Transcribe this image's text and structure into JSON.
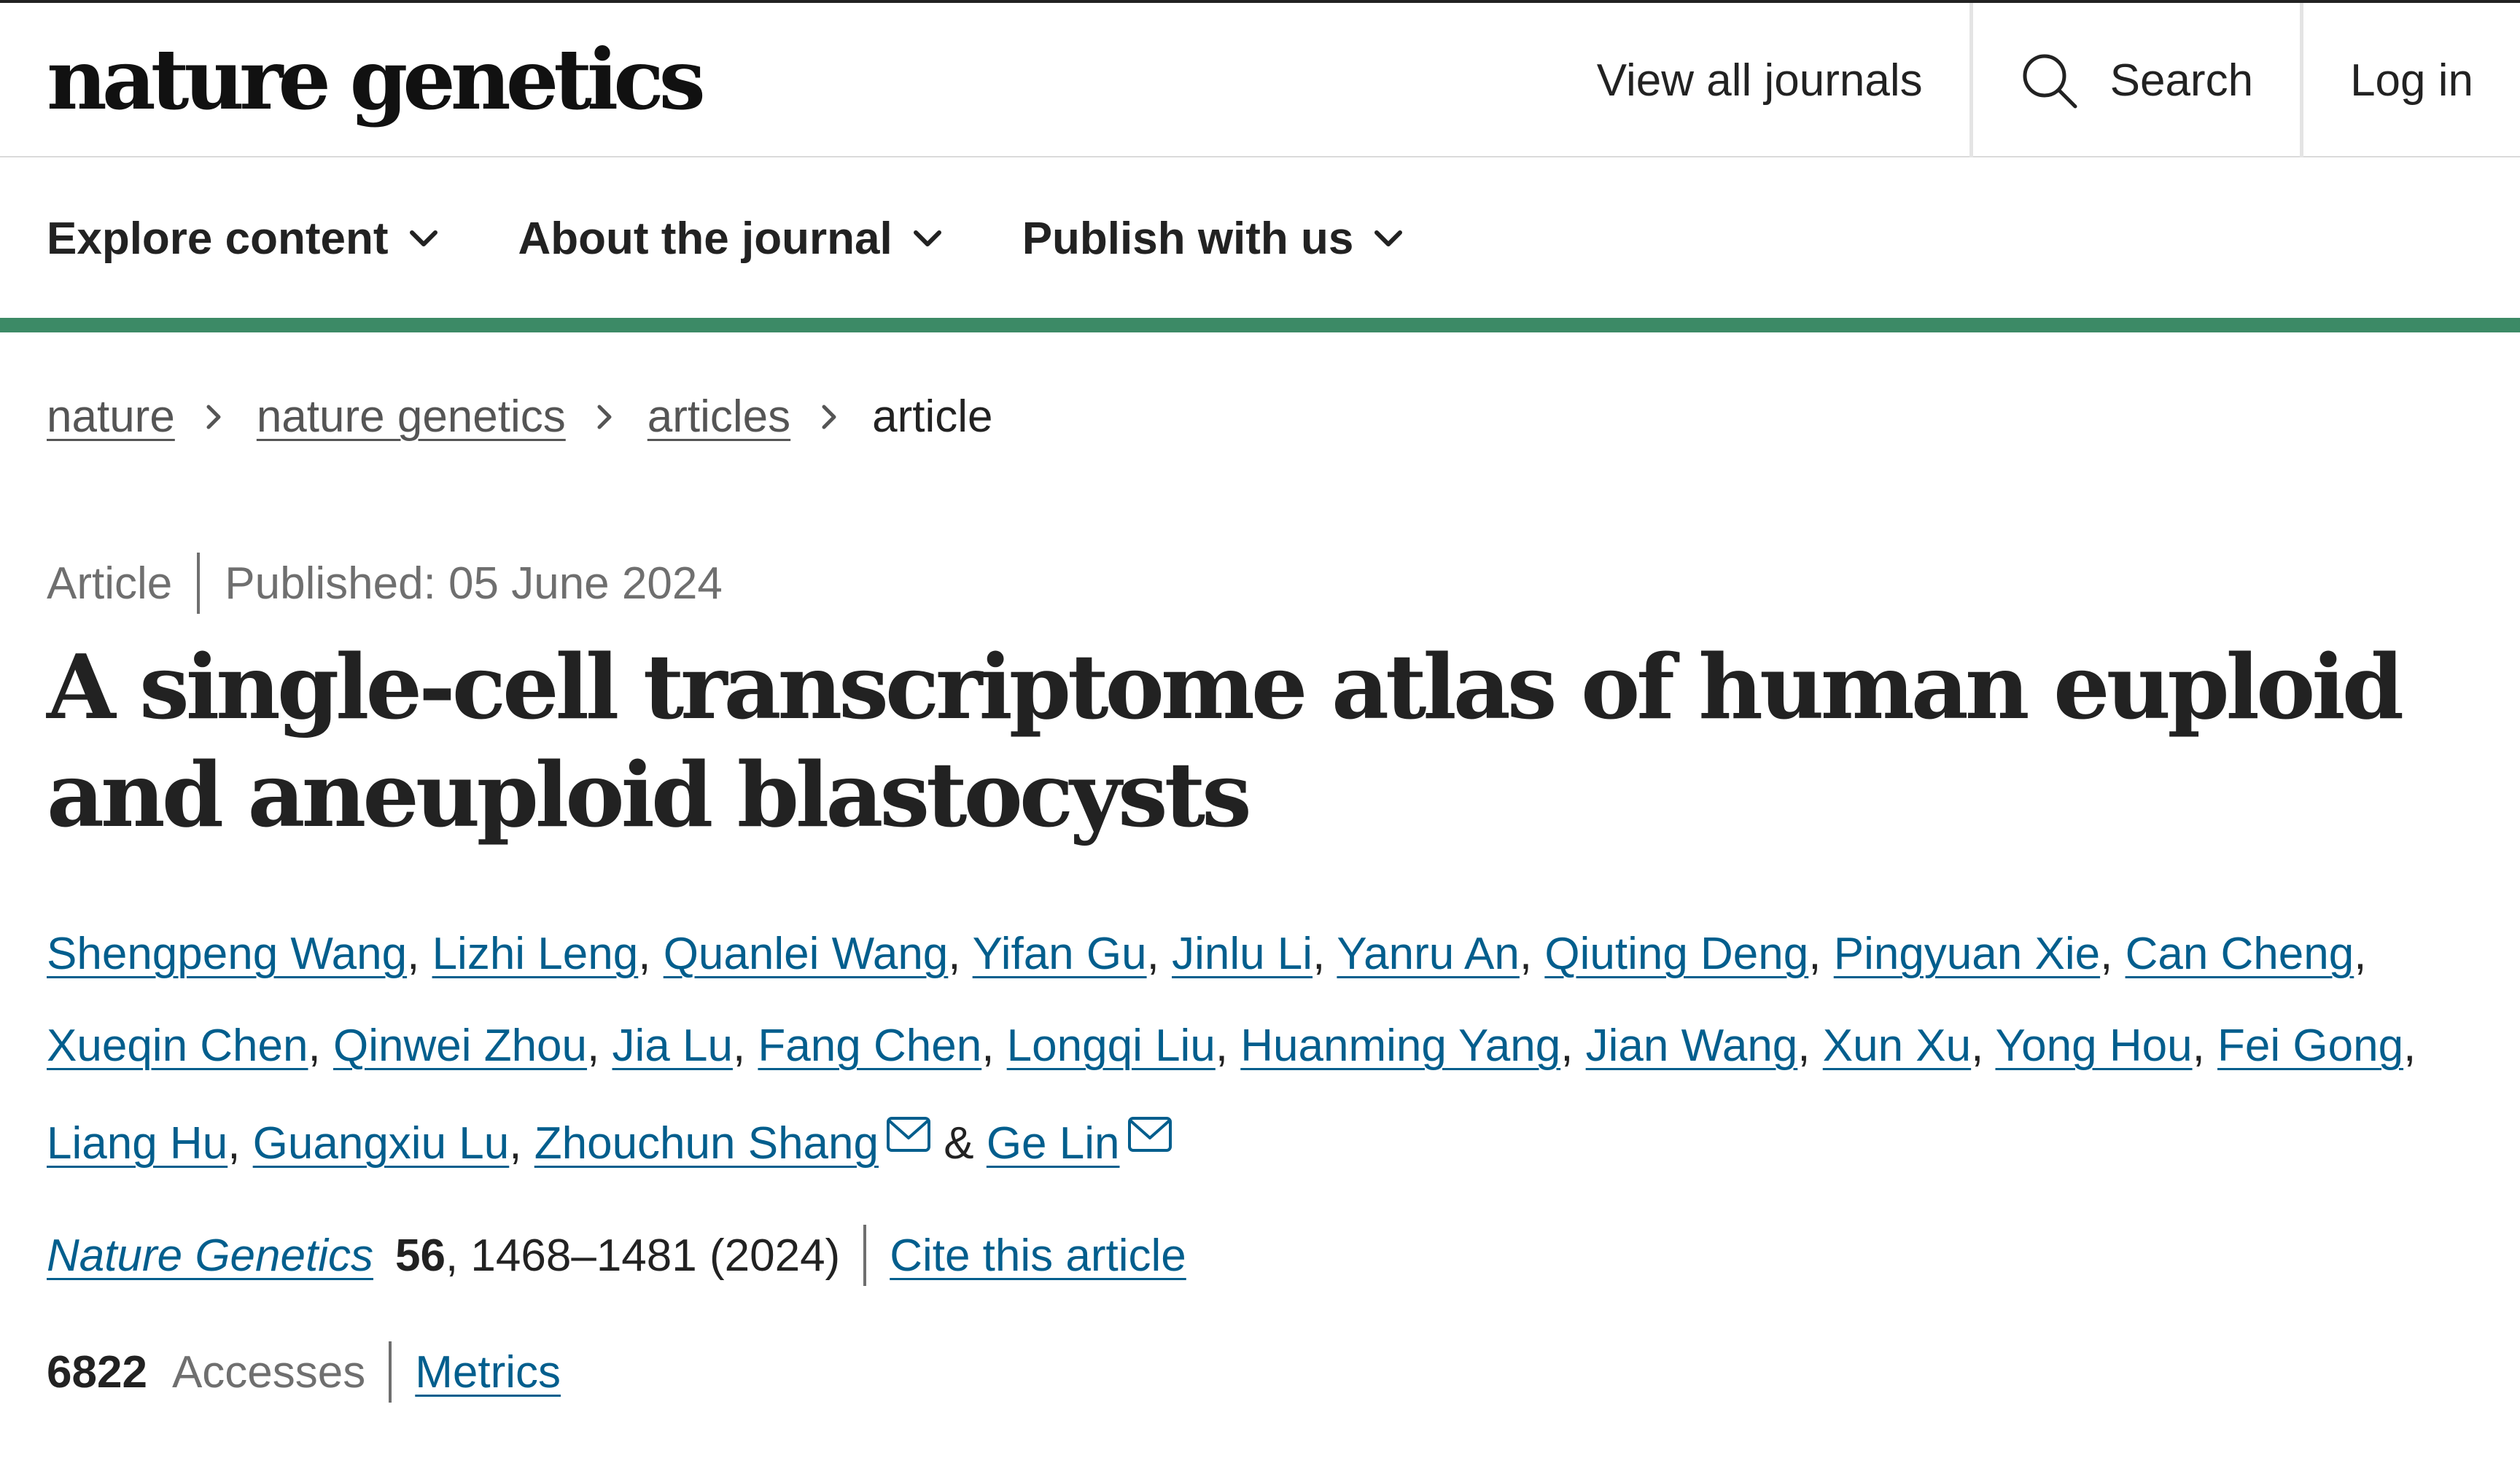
{
  "site": {
    "logo": "nature genetics",
    "accent_color": "#3c8a66",
    "link_color": "#025e8d"
  },
  "top_nav": {
    "view_all": "View all journals",
    "search": "Search",
    "search_icon": "search-icon",
    "login": "Log in"
  },
  "secondary_nav": [
    {
      "label": "Explore content"
    },
    {
      "label": "About the journal"
    },
    {
      "label": "Publish with us"
    }
  ],
  "breadcrumb": {
    "items": [
      "nature",
      "nature genetics",
      "articles"
    ],
    "current": "article"
  },
  "article": {
    "type": "Article",
    "published": "Published: 05 June 2024",
    "title": "A single-cell transcriptome atlas of human euploid and aneuploid blastocysts",
    "authors": [
      "Shengpeng Wang",
      "Lizhi Leng",
      "Quanlei Wang",
      "Yifan Gu",
      "Jinlu Li",
      "Yanru An",
      "Qiuting Deng",
      "Pingyuan Xie",
      "Can Cheng",
      "Xueqin Chen",
      "Qinwei Zhou",
      "Jia Lu",
      "Fang Chen",
      "Longqi Liu",
      "Huanming Yang",
      "Jian Wang",
      "Xun Xu",
      "Yong Hou",
      "Fei Gong",
      "Liang Hu",
      "Guangxiu Lu",
      "Zhouchun Shang"
    ],
    "last_author": "Ge Lin",
    "author_separator": ",",
    "and_symbol": "&",
    "mail_icon": "mail-icon"
  },
  "citation": {
    "journal": "Nature Genetics",
    "volume": "56",
    "pages_year": ", 1468–1481 (2024)",
    "cite_link": "Cite this article"
  },
  "metrics": {
    "accesses_count": "6822",
    "accesses_label": "Accesses",
    "metrics_link": "Metrics"
  }
}
